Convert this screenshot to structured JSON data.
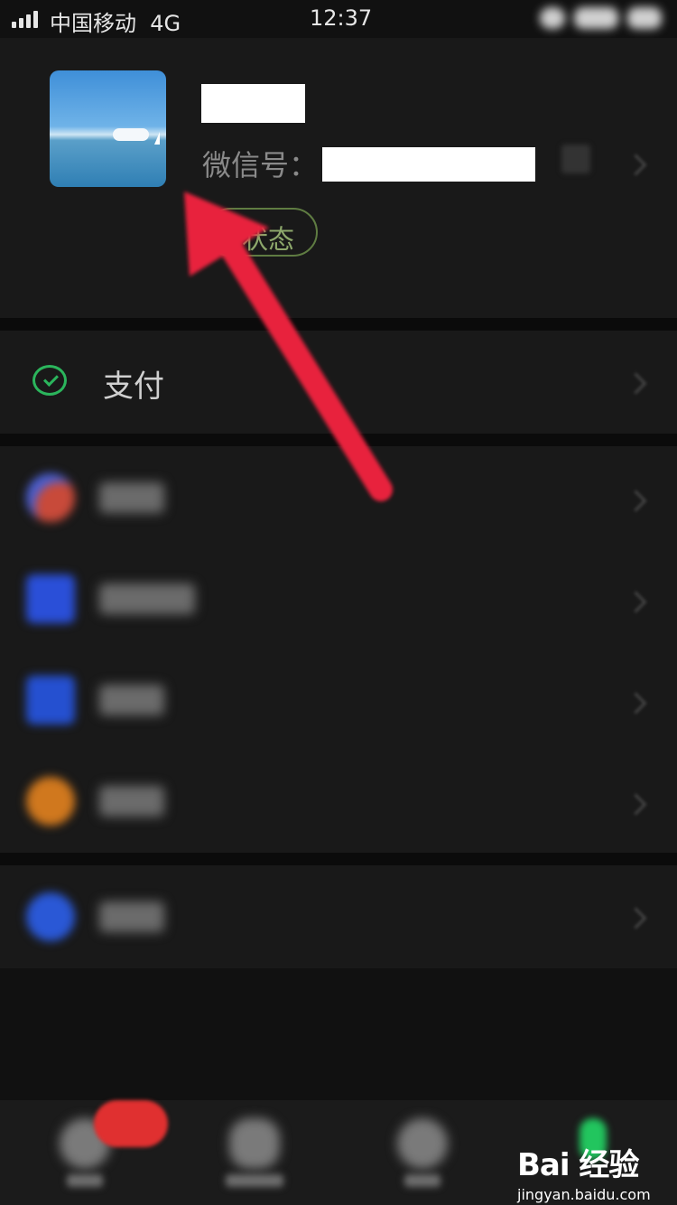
{
  "status_bar": {
    "carrier": "中国移动",
    "network": "4G",
    "time": "12:37"
  },
  "profile": {
    "wxid_label": "微信号：",
    "status_button": "状态"
  },
  "menu": {
    "pay_label": "支付"
  },
  "watermark": {
    "brand": "Bai 经验",
    "url": "jingyan.baidu.com"
  },
  "colors": {
    "accent_green": "#2bb55c",
    "arrow_red": "#e8243c",
    "background": "#111111",
    "card": "#191919"
  }
}
